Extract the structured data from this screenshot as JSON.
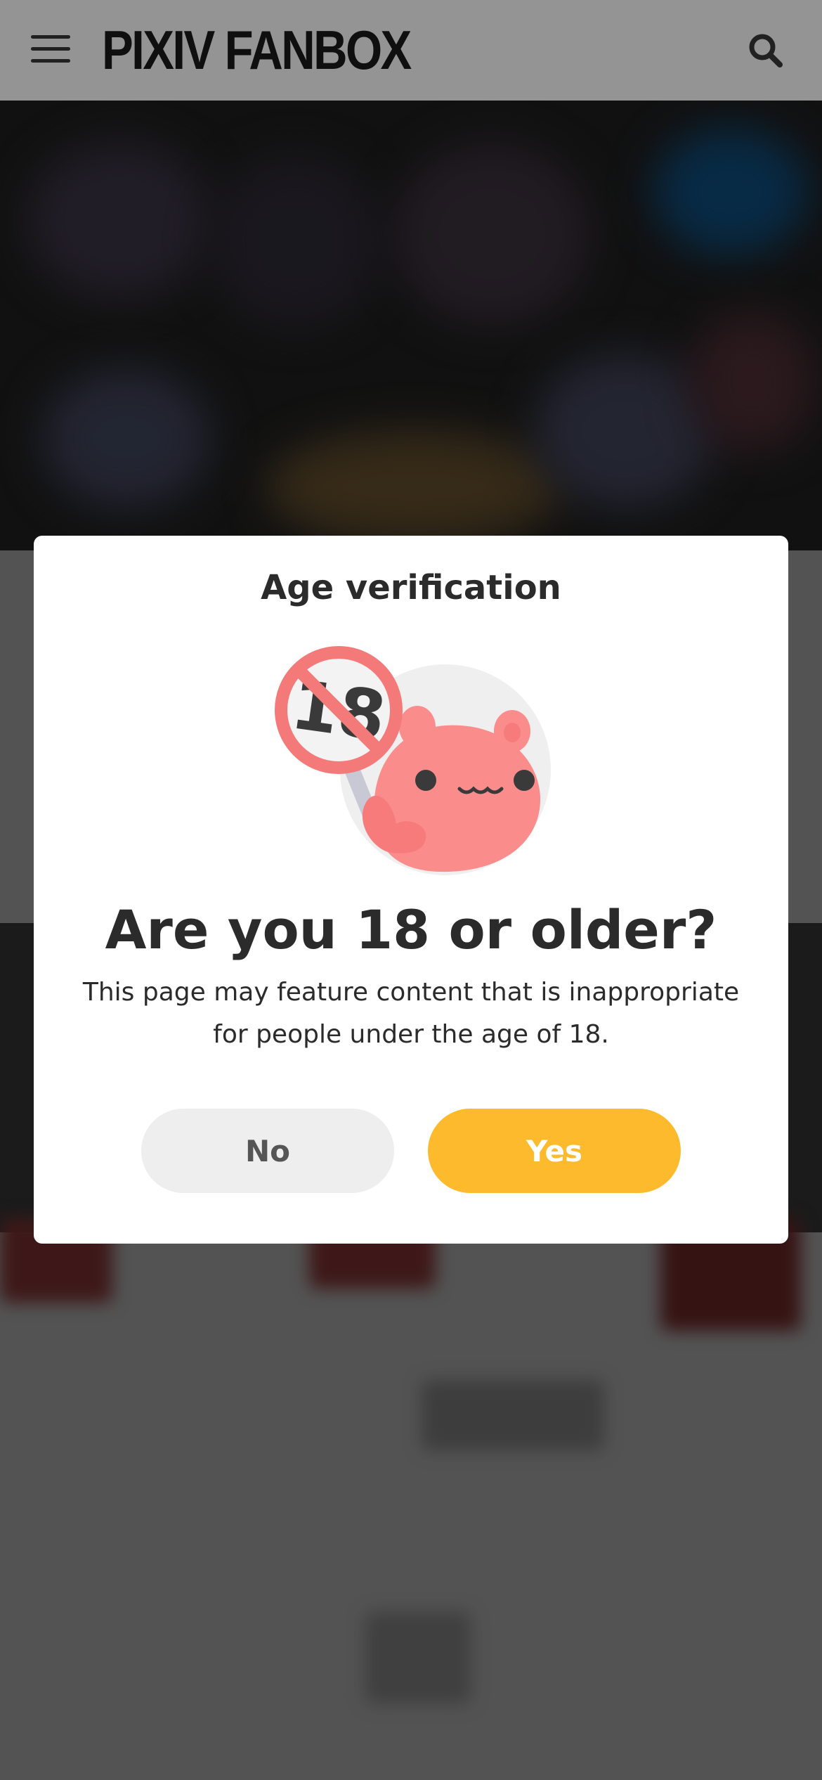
{
  "header": {
    "logo_text": "PIXIV FANBOX",
    "menu_icon": "hamburger-menu-icon",
    "search_icon": "search-icon"
  },
  "modal": {
    "title": "Age verification",
    "illustration_icon": "age-restricted-mascot-icon",
    "sign_text": "18",
    "question": "Are you 18 or older?",
    "description": "This page may feature content that is inappropriate for people under the age of 18.",
    "no_label": "No",
    "yes_label": "Yes"
  },
  "colors": {
    "accent_yellow": "#fdba2c",
    "no_button_bg": "#eeeeee",
    "mascot_pink": "#fa8c8c",
    "text_dark": "#2b2b2b"
  }
}
